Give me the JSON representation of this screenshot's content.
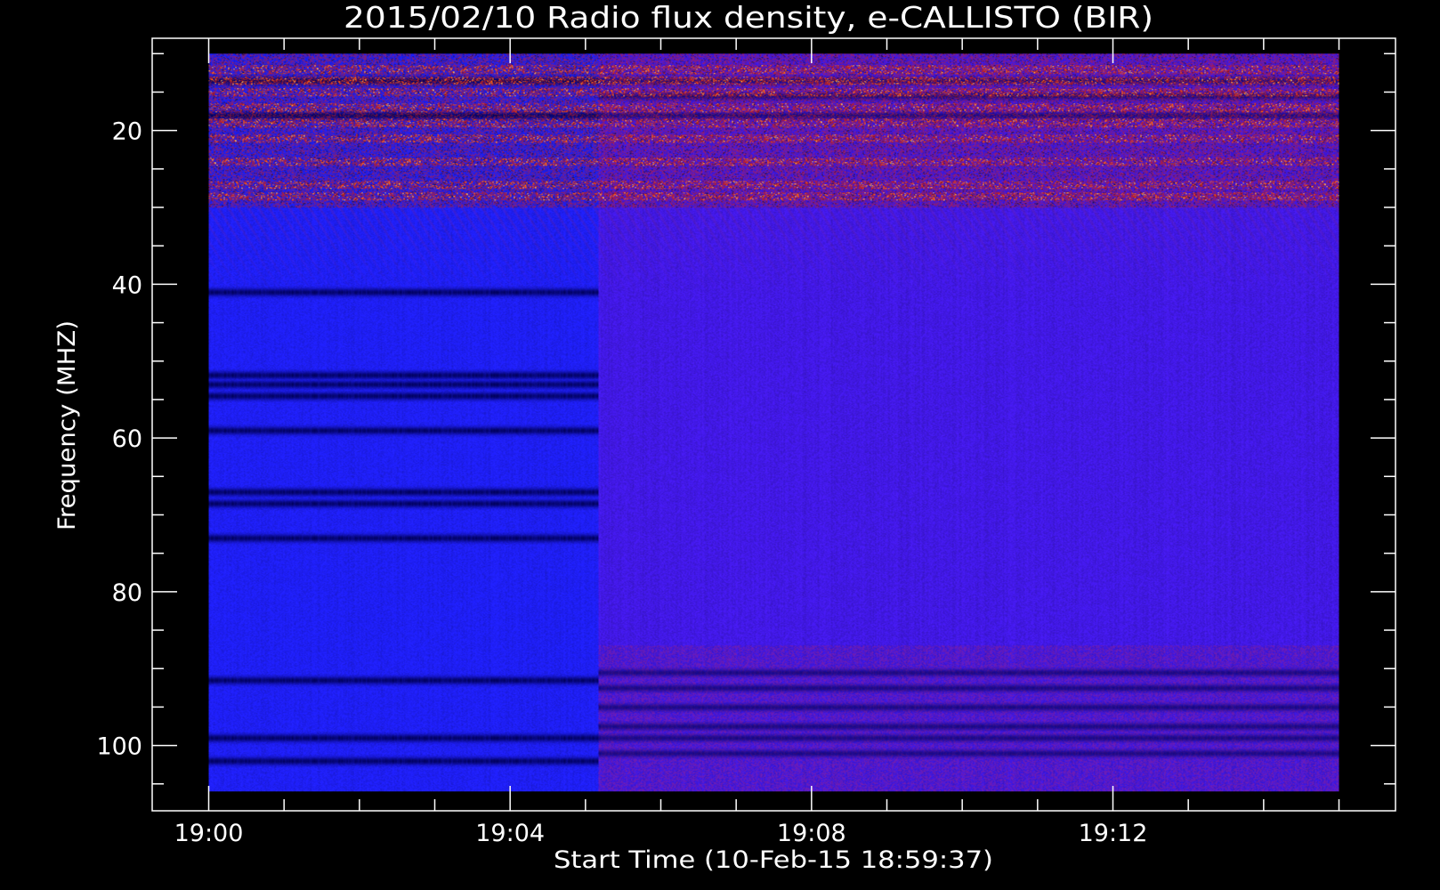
{
  "chart_data": {
    "type": "heatmap",
    "title": "2015/02/10  Radio flux density, e-CALLISTO (BIR)",
    "xlabel": "Start Time (10-Feb-15 18:59:37)",
    "ylabel": "Frequency (MHZ)",
    "x_tick_labels": [
      "19:00",
      "19:04",
      "19:08",
      "19:12"
    ],
    "y_tick_labels": [
      "20",
      "40",
      "60",
      "80",
      "100"
    ],
    "x_major_minutes": [
      0,
      4,
      8,
      12
    ],
    "y_major_values": [
      20,
      40,
      60,
      80,
      100
    ],
    "x_range_minutes": [
      -0.75,
      15.75
    ],
    "y_range_mhz": [
      8,
      108.5
    ],
    "data_x_range_minutes": [
      0,
      15
    ],
    "data_y_range_mhz": [
      10,
      106
    ],
    "regime_change_minute": 5.17,
    "rfi_band_mhz": [
      10,
      30
    ],
    "rfi_hotspot_freqs_mhz": [
      12,
      13.5,
      15,
      17,
      19,
      21,
      24,
      27,
      28.5
    ],
    "dark_bands_early_mhz": [
      13.5,
      18,
      41,
      51.8,
      53,
      54.5,
      59,
      67,
      68.5,
      73,
      91.5,
      99,
      102
    ],
    "dark_bands_late_mhz": [
      13.5,
      15.5,
      18,
      90.5,
      92.5,
      95,
      97.5,
      99,
      101
    ],
    "colors": {
      "background": "#000000",
      "axis": "#ffffff",
      "early_blue": "#1e1ef0",
      "late_blue": "#4018e0",
      "dark_band": "#00005a",
      "red": "#c81e14",
      "orange": "#ff6a14",
      "yellow": "#ffe678"
    }
  }
}
